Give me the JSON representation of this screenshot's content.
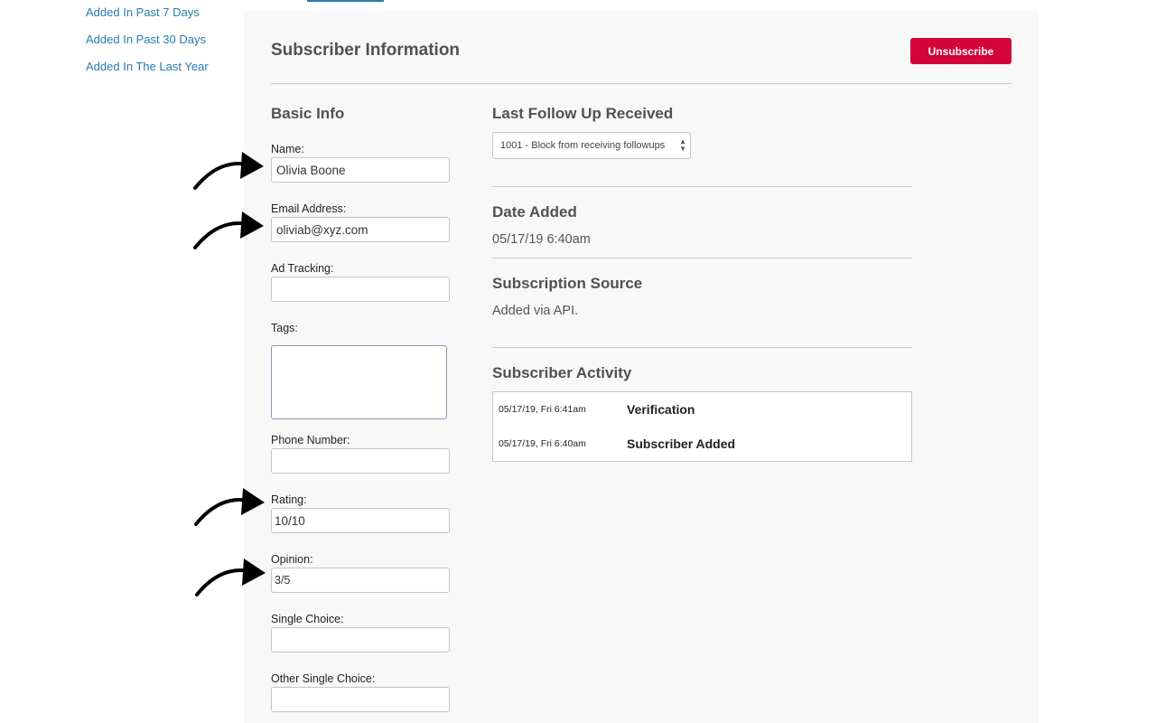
{
  "sidebar": {
    "links": [
      {
        "label": "Added In Past 7 Days"
      },
      {
        "label": "Added In Past 30 Days"
      },
      {
        "label": "Added In The Last Year"
      }
    ]
  },
  "header": {
    "title": "Subscriber Information",
    "unsubscribe_label": "Unsubscribe"
  },
  "basic_info": {
    "heading": "Basic Info",
    "name": {
      "label": "Name:",
      "value": "Olivia Boone"
    },
    "email": {
      "label": "Email Address:",
      "value": "oliviab@xyz.com"
    },
    "ad_tracking": {
      "label": "Ad Tracking:",
      "value": ""
    },
    "tags": {
      "label": "Tags:",
      "value": ""
    },
    "phone": {
      "label": "Phone Number:",
      "value": ""
    },
    "rating": {
      "label": "Rating:",
      "value": "10/10"
    },
    "opinion": {
      "label": "Opinion:",
      "value": "3/5"
    },
    "single_choice": {
      "label": "Single Choice:",
      "value": ""
    },
    "other_single_choice": {
      "label": "Other Single Choice:",
      "value": ""
    }
  },
  "follow_up": {
    "heading": "Last Follow Up Received",
    "selected": "1001 - Block from receiving followups"
  },
  "date_added": {
    "heading": "Date Added",
    "value": "05/17/19 6:40am"
  },
  "subscription_source": {
    "heading": "Subscription Source",
    "value": "Added via API."
  },
  "activity": {
    "heading": "Subscriber Activity",
    "rows": [
      {
        "time": "05/17/19, Fri 6:41am",
        "event": "Verification"
      },
      {
        "time": "05/17/19, Fri 6:40am",
        "event": "Subscriber Added"
      }
    ]
  },
  "colors": {
    "link": "#2a7ab0",
    "unsubscribe_button": "#d4053a",
    "panel_background": "#f8f8f8"
  }
}
